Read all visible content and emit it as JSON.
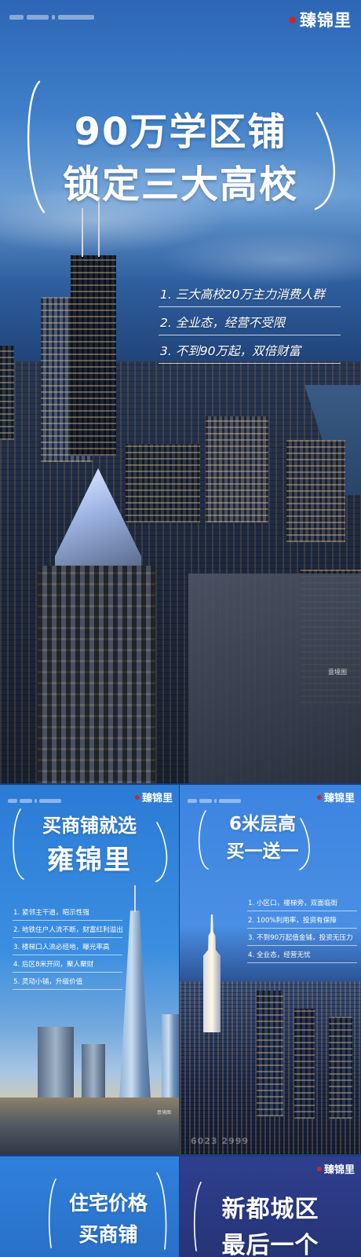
{
  "hero": {
    "brand_logo": "臻锦里",
    "headline_line1": "90万学区铺",
    "headline_line2": "锁定三大高校",
    "points": [
      "1. 三大高校20万主力消费人群",
      "2. 全业态，经营不受限",
      "3. 不到90万起，双倍财富"
    ],
    "image_credit": "意境图"
  },
  "panel_left": {
    "brand_logo": "臻锦里",
    "title_line1": "买商铺就选",
    "title_line2": "雍锦里",
    "points": [
      "1. 紧邻主干道，昭示性强",
      "2. 地铁住户人流不断，财富红利溢出",
      "3. 楼梯口人流必经地，曝光率高",
      "4. 后区8米开间，聚人聚财",
      "5. 灵动小铺，升级价值"
    ],
    "image_credit": "意境图"
  },
  "panel_right": {
    "brand_logo": "臻锦里",
    "title_line1": "6米层高",
    "title_line2": "买一送一",
    "points": [
      "1. 小区口，楼梯旁，双面临街",
      "2. 100%利用率，投资有保障",
      "3. 不到90万起值金铺，投资无压力",
      "4. 全业态，经营无忧"
    ],
    "phone": "6023 2999"
  },
  "panel_bottom_left": {
    "title_line1": "住宅价格",
    "title_line2": "买商铺"
  },
  "panel_bottom_right": {
    "brand_logo": "臻锦里",
    "title_line1": "新都城区",
    "title_line2": "最后一个"
  },
  "colors": {
    "accent_blue": "#3b8ee0",
    "seal_red": "#c22b2b",
    "text": "#ffffff"
  }
}
